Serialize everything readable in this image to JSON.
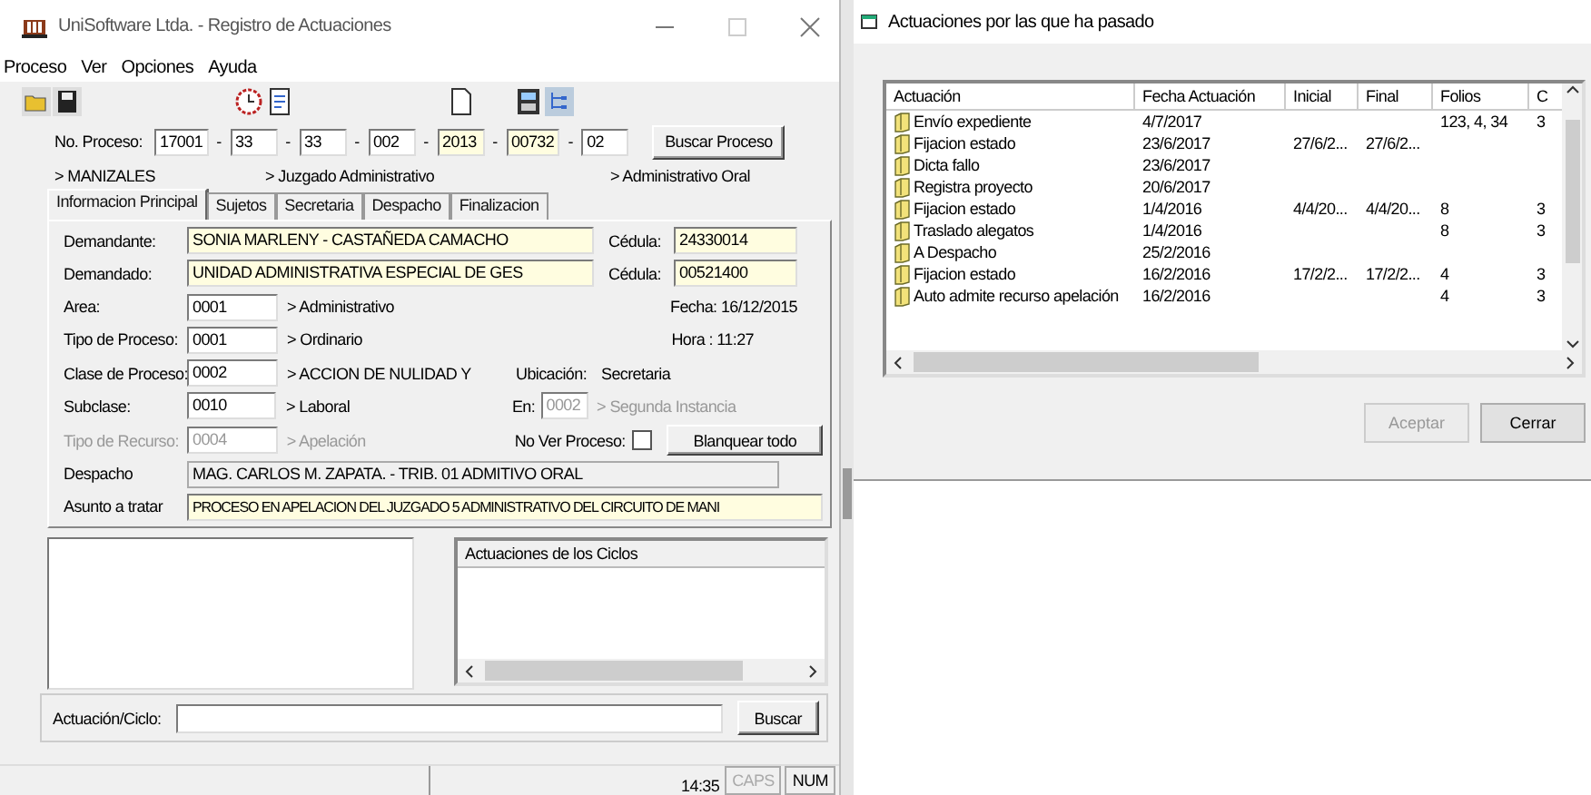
{
  "window": {
    "title": "UniSoftware Ltda. - Registro de Actuaciones"
  },
  "menu": [
    "Proceso",
    "Ver",
    "Opciones",
    "Ayuda"
  ],
  "proceso": {
    "label": "No. Proceso:",
    "parts": [
      {
        "kind": "field",
        "value": "17001",
        "highlight": false
      },
      {
        "kind": "sep",
        "value": "-"
      },
      {
        "kind": "field",
        "value": "33",
        "highlight": false
      },
      {
        "kind": "sep",
        "value": "-"
      },
      {
        "kind": "field",
        "value": "33",
        "highlight": false
      },
      {
        "kind": "sep",
        "value": "-"
      },
      {
        "kind": "field",
        "value": "002",
        "highlight": false
      },
      {
        "kind": "sep",
        "value": "-"
      },
      {
        "kind": "field",
        "value": "2013",
        "highlight": true
      },
      {
        "kind": "sep",
        "value": "-"
      },
      {
        "kind": "field",
        "value": "00732",
        "highlight": true
      },
      {
        "kind": "sep",
        "value": "-"
      },
      {
        "kind": "field",
        "value": "02",
        "highlight": false
      }
    ],
    "button": "Buscar Proceso"
  },
  "locations": [
    "> MANIZALES",
    "> Juzgado Administrativo",
    "> Administrativo Oral"
  ],
  "tabs": [
    {
      "label": "Informacion Principal",
      "selected": true
    },
    {
      "label": "Sujetos",
      "selected": false
    },
    {
      "label": "Secretaria",
      "selected": false
    },
    {
      "label": "Despacho",
      "selected": false
    },
    {
      "label": "Finalizacion",
      "selected": false
    }
  ],
  "parties": [
    {
      "label": "Demandante:",
      "value": "SONIA MARLENY - CASTAÑEDA CAMACHO",
      "id_label": "Cédula:",
      "id_value": "24330014"
    },
    {
      "label": "Demandado:",
      "value": "UNIDAD ADMINISTRATIVA ESPECIAL DE GES",
      "id_label": "Cédula:",
      "id_value": "00521400"
    }
  ],
  "codes": [
    {
      "label": "Area:",
      "code": "0001",
      "desc": "> Administrativo",
      "disabled": false
    },
    {
      "label": "Tipo de Proceso:",
      "code": "0001",
      "desc": "> Ordinario",
      "disabled": false
    },
    {
      "label": "Clase de Proceso:",
      "code": "0002",
      "desc": "> ACCION DE NULIDAD Y",
      "disabled": false
    },
    {
      "label": "Subclase:",
      "code": "0010",
      "desc": "> Laboral",
      "disabled": false
    },
    {
      "label": "Tipo de Recurso:",
      "code": "0004",
      "desc": "> Apelación",
      "disabled": true
    }
  ],
  "fecha": {
    "label": "Fecha:",
    "value": "16/12/2015"
  },
  "hora": {
    "label": "Hora :",
    "value": "11:27"
  },
  "ubicacion": {
    "label": "Ubicación:",
    "value": "Secretaria"
  },
  "en": {
    "label": "En:",
    "code": "0002",
    "desc": "> Segunda Instancia",
    "disabled": true
  },
  "no_ver": {
    "label": "No Ver Proceso:",
    "checked": false
  },
  "clear_button": "Blanquear todo",
  "despacho": {
    "label": "Despacho",
    "value": "MAG. CARLOS M. ZAPATA. - TRIB. 01 ADMITIVO ORAL"
  },
  "asunto": {
    "label": "Asunto a tratar",
    "value": "PROCESO EN  APELACION DEL JUZGADO 5 ADMINISTRATIVO  DEL CIRCUITO DE  MANI"
  },
  "ciclos": {
    "header": "Actuaciones de los Ciclos"
  },
  "search": {
    "label": "Actuación/Ciclo:",
    "button": "Buscar"
  },
  "status_bar": {
    "time": "14:35",
    "keys": [
      {
        "label": "CAPS",
        "on": false
      },
      {
        "label": "NUM",
        "on": true
      }
    ]
  },
  "dialog": {
    "title": "Actuaciones por las que ha pasado",
    "columns": [
      "Actuación",
      "Fecha Actuación",
      "Inicial",
      "Final",
      "Folios",
      "C"
    ],
    "rows": [
      [
        "Envío expediente",
        "4/7/2017",
        "",
        "",
        "123, 4, 34",
        "3"
      ],
      [
        "Fijacion estado",
        "23/6/2017",
        "27/6/2...",
        "27/6/2...",
        "",
        ""
      ],
      [
        "Dicta fallo",
        "23/6/2017",
        "",
        "",
        "",
        ""
      ],
      [
        "Registra proyecto",
        "20/6/2017",
        "",
        "",
        "",
        ""
      ],
      [
        "Fijacion estado",
        "1/4/2016",
        "4/4/20...",
        "4/4/20...",
        "8",
        "3"
      ],
      [
        "Traslado alegatos",
        "1/4/2016",
        "",
        "",
        "8",
        "3"
      ],
      [
        "A Despacho",
        "25/2/2016",
        "",
        "",
        "",
        ""
      ],
      [
        "Fijacion estado",
        "16/2/2016",
        "17/2/2...",
        "17/2/2...",
        "4",
        "3"
      ],
      [
        "Auto admite recurso apelación",
        "16/2/2016",
        "",
        "",
        "4",
        "3"
      ]
    ],
    "buttons": [
      {
        "label": "Aceptar",
        "disabled": true
      },
      {
        "label": "Cerrar",
        "disabled": false
      }
    ]
  }
}
